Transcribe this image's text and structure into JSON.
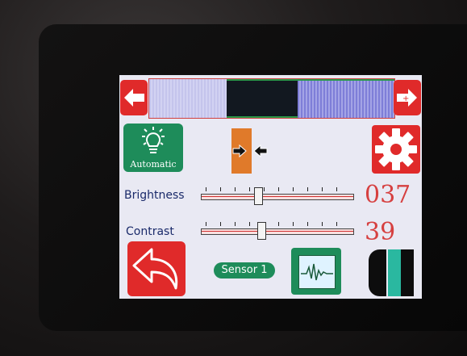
{
  "controls": {
    "prev_icon": "arrow-left-icon",
    "next_icon": "arrow-right-icon",
    "mode_label": "Automatic",
    "mode_icon": "lightbulb-icon",
    "swap_icon": "arrows-in-icon",
    "settings_icon": "gear-icon"
  },
  "brightness": {
    "label": "Brightness",
    "value": "037",
    "level": 0.37
  },
  "contrast": {
    "label": "Contrast",
    "value": "39",
    "level": 0.39
  },
  "bottom": {
    "back_icon": "undo-arrow-icon",
    "sensor_label": "Sensor 1",
    "graph_icon": "waveform-monitor-icon",
    "color_icon": "black-white-teal-swatch-icon"
  },
  "colors": {
    "red": "#e02a2a",
    "green": "#1e8c5a",
    "orange": "#e07a2a",
    "value_red": "#d64040"
  }
}
